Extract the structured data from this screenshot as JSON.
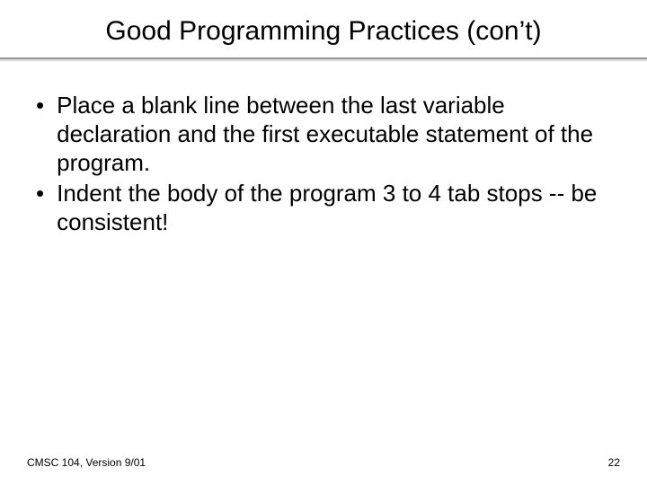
{
  "title": "Good Programming Practices (con’t)",
  "bullets": [
    {
      "text": "Place a blank line between the last variable declaration and the first executable statement of the program."
    },
    {
      "text": "Indent the body of the program 3 to 4 tab stops -- be consistent!"
    }
  ],
  "footer": {
    "left": "CMSC 104, Version 9/01",
    "right": "22"
  }
}
